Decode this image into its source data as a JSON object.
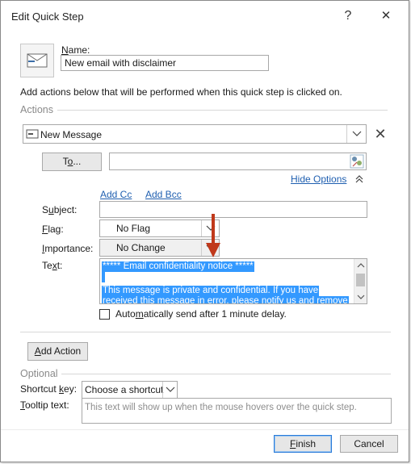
{
  "window": {
    "title": "Edit Quick Step",
    "help_glyph": "?",
    "close_glyph": "✕"
  },
  "name": {
    "label_u": "N",
    "label_rest": "ame:",
    "value": "New email with disclaimer"
  },
  "instruction": "Add actions below that will be performed when this quick step is clicked on.",
  "actions": {
    "group_label": "Actions",
    "action_type": "New Message",
    "remove_glyph": "✕",
    "to_button_u": "o",
    "to_button_pre": "T",
    "to_button_post": "...",
    "to_value": "",
    "hide_options": "Hide Options",
    "add_cc": "Add Cc",
    "add_bcc": "Add Bcc",
    "subject_label_pre": "S",
    "subject_label_u": "u",
    "subject_label_post": "bject:",
    "subject_value": "",
    "flag_label_u": "F",
    "flag_label_post": "lag:",
    "flag_value": "No Flag",
    "importance_label_u": "I",
    "importance_label_post": "mportance:",
    "importance_value": "No Change",
    "text_label_pre": "Te",
    "text_label_u": "x",
    "text_label_post": "t:",
    "text_lines": [
      "***** Email confidentiality notice *****",
      "",
      "This message is private and confidential. If you have",
      "received this message in error, please notify us and remove"
    ],
    "auto_send_pre": "Auto",
    "auto_send_u": "m",
    "auto_send_post": "atically send after 1 minute delay.",
    "auto_send_checked": false
  },
  "add_action": {
    "label_u": "A",
    "label_post": "dd Action"
  },
  "optional": {
    "group_label": "Optional",
    "shortcut_label_pre": "Shortcut ",
    "shortcut_label_u": "k",
    "shortcut_label_post": "ey:",
    "shortcut_value": "Choose a shortcut",
    "tooltip_label_u": "T",
    "tooltip_label_post": "ooltip text:",
    "tooltip_placeholder": "This text will show up when the mouse hovers over the quick step."
  },
  "footer": {
    "finish_u": "F",
    "finish_post": "inish",
    "cancel": "Cancel"
  },
  "colors": {
    "annotation_arrow": "#c0391b",
    "selection": "#3399ff",
    "link": "#1f5fb0"
  }
}
